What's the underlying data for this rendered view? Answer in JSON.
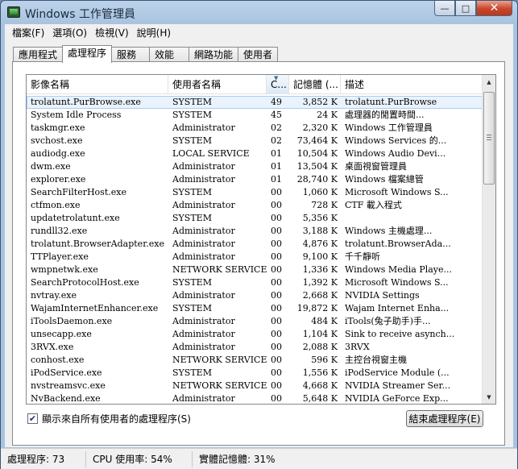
{
  "window": {
    "title": "Windows 工作管理員"
  },
  "window_buttons": {
    "minimize": "—",
    "maximize": "□",
    "close": "✕"
  },
  "menu": [
    "檔案(F)",
    "選項(O)",
    "檢視(V)",
    "說明(H)"
  ],
  "tabs": [
    "應用程式",
    "處理程序",
    "服務",
    "效能",
    "網路功能",
    "使用者"
  ],
  "active_tab": "處理程序",
  "columns": [
    "影像名稱",
    "使用者名稱",
    "C...",
    "記憶體 (...",
    "描述"
  ],
  "sort_indicator": "▼",
  "processes": [
    {
      "name": "trolatunt.PurBrowse.exe",
      "user": "SYSTEM",
      "cpu": "49",
      "mem": "3,852 K",
      "desc": "trolatunt.PurBrowse",
      "selected": true
    },
    {
      "name": "System Idle Process",
      "user": "SYSTEM",
      "cpu": "45",
      "mem": "24 K",
      "desc": "處理器的閒置時間..."
    },
    {
      "name": "taskmgr.exe",
      "user": "Administrator",
      "cpu": "02",
      "mem": "2,320 K",
      "desc": "Windows 工作管理員"
    },
    {
      "name": "svchost.exe",
      "user": "SYSTEM",
      "cpu": "02",
      "mem": "73,464 K",
      "desc": "Windows Services 的..."
    },
    {
      "name": "audiodg.exe",
      "user": "LOCAL SERVICE",
      "cpu": "01",
      "mem": "10,504 K",
      "desc": "Windows Audio Devi..."
    },
    {
      "name": "dwm.exe",
      "user": "Administrator",
      "cpu": "01",
      "mem": "13,504 K",
      "desc": "桌面視窗管理員"
    },
    {
      "name": "explorer.exe",
      "user": "Administrator",
      "cpu": "01",
      "mem": "28,740 K",
      "desc": "Windows 檔案總管"
    },
    {
      "name": "SearchFilterHost.exe",
      "user": "SYSTEM",
      "cpu": "00",
      "mem": "1,060 K",
      "desc": "Microsoft Windows S..."
    },
    {
      "name": "ctfmon.exe",
      "user": "Administrator",
      "cpu": "00",
      "mem": "728 K",
      "desc": "CTF 載入程式"
    },
    {
      "name": "updatetrolatunt.exe",
      "user": "SYSTEM",
      "cpu": "00",
      "mem": "5,356 K",
      "desc": ""
    },
    {
      "name": "rundll32.exe",
      "user": "Administrator",
      "cpu": "00",
      "mem": "3,188 K",
      "desc": "Windows 主機處理..."
    },
    {
      "name": "trolatunt.BrowserAdapter.exe",
      "user": "Administrator",
      "cpu": "00",
      "mem": "4,876 K",
      "desc": "trolatunt.BrowserAda..."
    },
    {
      "name": "TTPlayer.exe",
      "user": "Administrator",
      "cpu": "00",
      "mem": "9,100 K",
      "desc": "千千靜听"
    },
    {
      "name": "wmpnetwk.exe",
      "user": "NETWORK SERVICE",
      "cpu": "00",
      "mem": "1,336 K",
      "desc": "Windows Media Playe..."
    },
    {
      "name": "SearchProtocolHost.exe",
      "user": "SYSTEM",
      "cpu": "00",
      "mem": "1,392 K",
      "desc": "Microsoft Windows S..."
    },
    {
      "name": "nvtray.exe",
      "user": "Administrator",
      "cpu": "00",
      "mem": "2,668 K",
      "desc": "NVIDIA Settings"
    },
    {
      "name": "WajamInternetEnhancer.exe",
      "user": "SYSTEM",
      "cpu": "00",
      "mem": "19,872 K",
      "desc": "Wajam Internet Enha..."
    },
    {
      "name": "iToolsDaemon.exe",
      "user": "Administrator",
      "cpu": "00",
      "mem": "484 K",
      "desc": "iTools(兔子助手)手..."
    },
    {
      "name": "unsecapp.exe",
      "user": "Administrator",
      "cpu": "00",
      "mem": "1,104 K",
      "desc": "Sink to receive asynch..."
    },
    {
      "name": "3RVX.exe",
      "user": "Administrator",
      "cpu": "00",
      "mem": "2,088 K",
      "desc": "3RVX"
    },
    {
      "name": "conhost.exe",
      "user": "NETWORK SERVICE",
      "cpu": "00",
      "mem": "596 K",
      "desc": "主控台視窗主機"
    },
    {
      "name": "iPodService.exe",
      "user": "SYSTEM",
      "cpu": "00",
      "mem": "1,556 K",
      "desc": "iPodService Module (..."
    },
    {
      "name": "nvstreamsvc.exe",
      "user": "NETWORK SERVICE",
      "cpu": "00",
      "mem": "4,668 K",
      "desc": "NVIDIA Streamer Ser..."
    },
    {
      "name": "NvBackend.exe",
      "user": "Administrator",
      "cpu": "00",
      "mem": "5,648 K",
      "desc": "NVIDIA GeForce Exp..."
    }
  ],
  "scrollbar": {
    "up_arrow": "▲",
    "down_arrow": "▼"
  },
  "show_all": {
    "checked": true,
    "check_mark": "✔",
    "label": "顯示來自所有使用者的處理程序(S)"
  },
  "end_button": "結束處理程序(E)",
  "status": {
    "processes": "處理程序: 73",
    "cpu": "CPU 使用率: 54%",
    "memory": "實體記憶體: 31%"
  }
}
